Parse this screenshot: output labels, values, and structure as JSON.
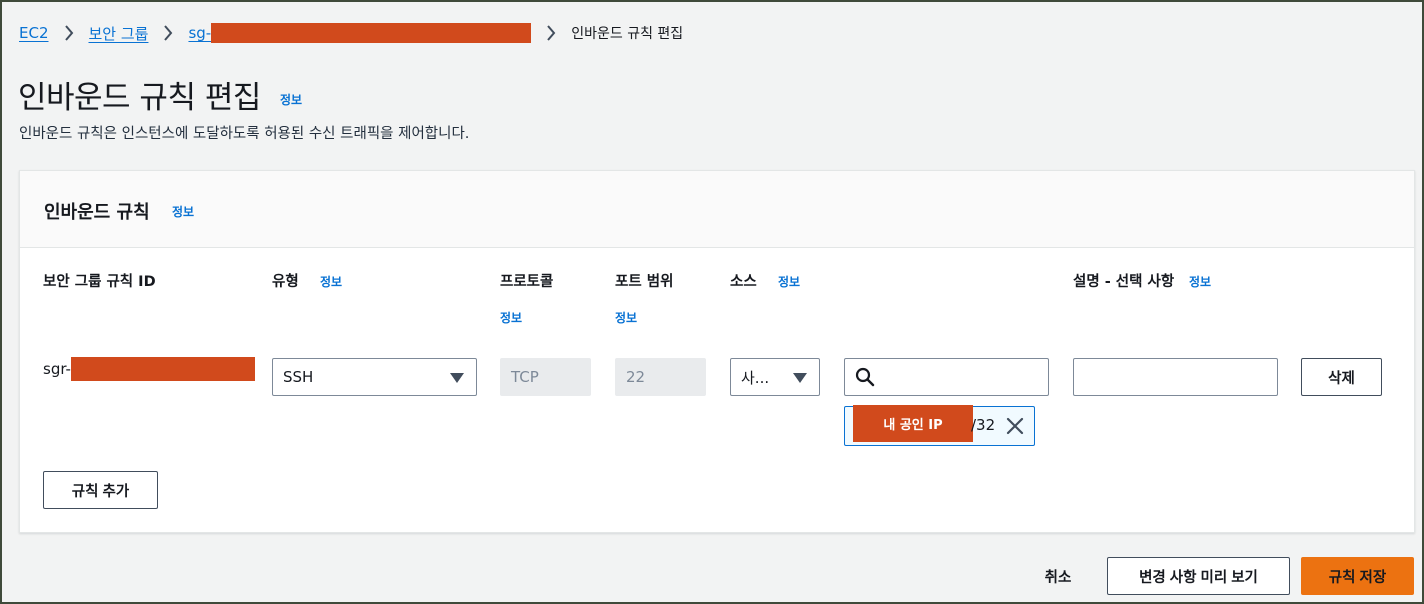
{
  "breadcrumb": {
    "ec2": "EC2",
    "security_groups": "보안 그룹",
    "sg_prefix": "sg-",
    "current": "인바운드 규칙 편집"
  },
  "header": {
    "title": "인바운드 규칙 편집",
    "info": "정보",
    "description": "인바운드 규칙은 인스턴스에 도달하도록 허용된 수신 트래픽을 제어합니다."
  },
  "panel": {
    "title": "인바운드 규칙",
    "info": "정보",
    "columns": {
      "rule_id": "보안 그룹 규칙 ID",
      "type": "유형",
      "type_info": "정보",
      "protocol": "프로토콜",
      "protocol_info": "정보",
      "port_range": "포트 범위",
      "port_range_info": "정보",
      "source": "소스",
      "source_info": "정보",
      "description": "설명 - 선택 사항",
      "description_info": "정보"
    },
    "row": {
      "rule_id_prefix": "sgr-",
      "type": "SSH",
      "protocol": "TCP",
      "port": "22",
      "source_type": "사...",
      "source_search": "",
      "description": "",
      "delete": "삭제",
      "token_label": "내 공인 IP",
      "token_value": "/32"
    },
    "add_rule": "규칙 추가"
  },
  "footer": {
    "cancel": "취소",
    "preview": "변경 사항 미리 보기",
    "save": "규칙 저장"
  },
  "colors": {
    "link": "#0972d3",
    "primary": "#ec7211",
    "redaction": "#d14a1c"
  }
}
